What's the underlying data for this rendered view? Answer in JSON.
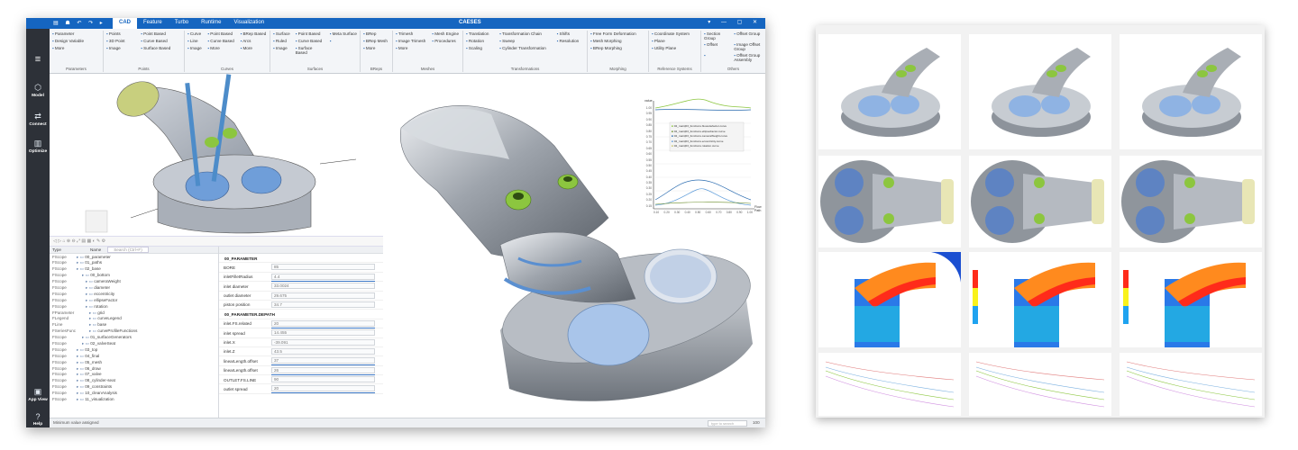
{
  "window": {
    "title": "CAESES",
    "quick_access": "▤ ☗ ↶ ↷ ▸",
    "window_controls": "▾ — ▢ ✕",
    "tabs": [
      {
        "label": "CAD"
      },
      {
        "label": "Feature"
      },
      {
        "label": "Turbo"
      },
      {
        "label": "Runtime"
      },
      {
        "label": "Visualization"
      }
    ]
  },
  "ribbon": {
    "groups": [
      {
        "title": "Parameters",
        "items": [
          "Parameter",
          "Design Variable",
          "More"
        ]
      },
      {
        "title": "Points",
        "items": [
          "Points",
          "3D Point",
          "Image",
          "Point Based",
          "Curve Based",
          "Surface Based"
        ]
      },
      {
        "title": "Curves",
        "items": [
          "Curve",
          "Line",
          "Image",
          "Point Based",
          "Curve Based",
          "More",
          "BRep Based",
          "Arcs",
          "More"
        ]
      },
      {
        "title": "Surfaces",
        "items": [
          "Surface",
          "Ruled",
          "Image",
          "Point Based",
          "Curve Based",
          "Surface Based",
          "Meta Surface"
        ]
      },
      {
        "title": "BReps",
        "items": [
          "BRep",
          "BRep Mesh",
          "More"
        ]
      },
      {
        "title": "Meshes",
        "items": [
          "Trimesh",
          "Image Trimesh",
          "More",
          "Mesh Engine",
          "Procedures"
        ]
      },
      {
        "title": "Transformations",
        "items": [
          "Translation",
          "Rotation",
          "Scaling",
          "Transformation Chain",
          "Sweep",
          "Cylinder Transformation",
          "Shifts",
          "Resolution"
        ]
      },
      {
        "title": "Morphing",
        "items": [
          "Free Form Deformation",
          "Mesh Morphing",
          "BRep Morphing"
        ]
      },
      {
        "title": "Reference Systems",
        "items": [
          "Coordinate System",
          "Plane",
          "Utility Plane"
        ]
      },
      {
        "title": "Others",
        "items": [
          "Section Group",
          "Offset",
          "Offset Group",
          "Image Offset Group",
          "Offset Group Assembly"
        ]
      }
    ]
  },
  "nav": {
    "items": [
      {
        "label": "Model",
        "icon": "cube-icon"
      },
      {
        "label": "Connect",
        "icon": "connect-icon"
      },
      {
        "label": "Optimize",
        "icon": "chart-icon"
      },
      {
        "label": "App View",
        "icon": "app-view-icon"
      },
      {
        "label": "Help",
        "icon": "help-icon"
      }
    ]
  },
  "tree": {
    "headers": [
      "Type",
      "Name",
      "Search (Ctrl+F)"
    ],
    "rows": [
      {
        "type": "FScope",
        "name": "00_parameter"
      },
      {
        "type": "FScope",
        "name": "01_paths"
      },
      {
        "type": "FScope",
        "name": "02_base"
      },
      {
        "type": "FScope",
        "name": "00_bottom"
      },
      {
        "type": "FScope",
        "name": "cameraWeight"
      },
      {
        "type": "FScope",
        "name": "diameter"
      },
      {
        "type": "FScope",
        "name": "eccentricity"
      },
      {
        "type": "FScope",
        "name": "ellipseFactor"
      },
      {
        "type": "FScope",
        "name": "rotation"
      },
      {
        "type": "FParameter",
        "name": "grid"
      },
      {
        "type": "FLegend",
        "name": "curveLegend"
      },
      {
        "type": "FLine",
        "name": "base"
      },
      {
        "type": "FSeriesFunc",
        "name": "curveProfileFunctions"
      },
      {
        "type": "FScope",
        "name": "01_surfaceGenerators"
      },
      {
        "type": "FScope",
        "name": "02_valveSeat"
      },
      {
        "type": "FScope",
        "name": "03_top"
      },
      {
        "type": "FScope",
        "name": "04_final"
      },
      {
        "type": "FScope",
        "name": "05_mesh"
      },
      {
        "type": "FScope",
        "name": "06_draw"
      },
      {
        "type": "FScope",
        "name": "07_valve"
      },
      {
        "type": "FScope",
        "name": "08_cylinder-seat"
      },
      {
        "type": "FScope",
        "name": "09_constraints"
      },
      {
        "type": "FScope",
        "name": "10_cleanAnalysis"
      },
      {
        "type": "FScope",
        "name": "11_visualization"
      }
    ]
  },
  "params": {
    "rows": [
      {
        "kind": "sect",
        "label": "00_PARAMETER",
        "value": ""
      },
      {
        "kind": "field",
        "label": "BORE",
        "value": "85"
      },
      {
        "kind": "slider",
        "label": "inletFilletRadius",
        "value": "4.4"
      },
      {
        "kind": "field",
        "label": "inlet diameter",
        "value": "33.0024"
      },
      {
        "kind": "field",
        "label": "outlet diameter",
        "value": "29.675"
      },
      {
        "kind": "field",
        "label": "piston position",
        "value": "34.7"
      },
      {
        "kind": "sect",
        "label": "00_PARAMETER.DEPATH",
        "value": ""
      },
      {
        "kind": "slider",
        "label": "inlet.FS.related",
        "value": "20"
      },
      {
        "kind": "field",
        "label": "inlet spread",
        "value": "14.455"
      },
      {
        "kind": "field",
        "label": "inlet.X",
        "value": "-39.091"
      },
      {
        "kind": "field",
        "label": "inlet.Z",
        "value": "43.5"
      },
      {
        "kind": "slider",
        "label": "linearLength.offset",
        "value": "37"
      },
      {
        "kind": "slider",
        "label": "linearLength.offset",
        "value": "26"
      },
      {
        "kind": "field",
        "label": "OUTLET.FS.LINE",
        "value": "90"
      },
      {
        "kind": "slider",
        "label": "outlet spread",
        "value": "20"
      }
    ]
  },
  "status": {
    "message": "Minimum value assigned",
    "search_placeholder": "type to search",
    "zoom": "100"
  },
  "graph": {
    "legend": [
      "02_main|03_functions.bloweitefactor.curve",
      "02_main|03_functions.ellipseFactor.curve",
      "02_main|03_functions.cameraWeight.curve",
      "02_main|03_functions.eccentricity.curve",
      "02_main|03_functions.rotation.curve"
    ],
    "xlabel": "Flow Path",
    "ytop": "value",
    "ticks_y": [
      "1.00",
      "0.95",
      "0.90",
      "0.85",
      "0.80",
      "0.75",
      "0.70",
      "0.65",
      "0.60",
      "0.55",
      "0.50",
      "0.45",
      "0.40",
      "0.35",
      "0.30",
      "0.25",
      "0.20",
      "0.15"
    ],
    "ticks_x": [
      "0.10",
      "0.20",
      "0.30",
      "0.40",
      "0.50",
      "0.60",
      "0.70",
      "0.80",
      "0.90",
      "1.00"
    ]
  },
  "colors": {
    "accent": "#1565c0",
    "nav_bg": "#2d3138",
    "port_metal": "#a7acb3",
    "valve_green": "#8cc63f",
    "seat_blue": "#6f9ed9"
  }
}
